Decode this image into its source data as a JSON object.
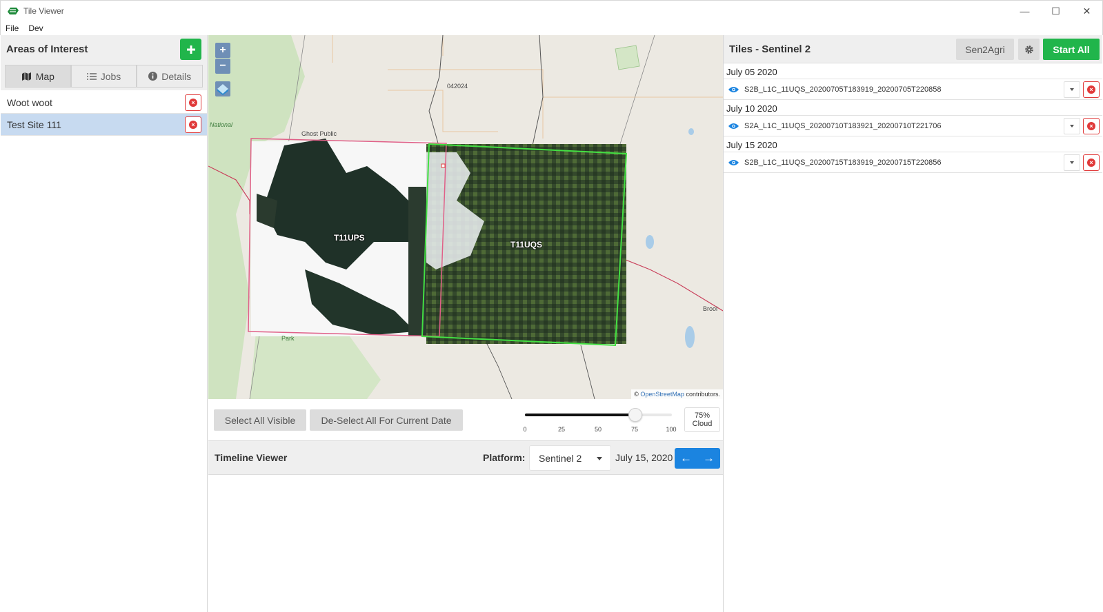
{
  "window": {
    "title": "Tile Viewer",
    "minimize_icon": "minimize-icon",
    "maximize_icon": "maximize-icon",
    "close_icon": "close-icon"
  },
  "menu": {
    "items": [
      "File",
      "Dev"
    ]
  },
  "aoi": {
    "title": "Areas of Interest",
    "add_icon": "plus-icon",
    "tabs": [
      {
        "label": "Map",
        "icon": "map-icon",
        "active": true
      },
      {
        "label": "Jobs",
        "icon": "list-icon",
        "active": false
      },
      {
        "label": "Details",
        "icon": "info-icon",
        "active": false
      }
    ],
    "items": [
      {
        "name": "Woot woot",
        "selected": false
      },
      {
        "name": "Test Site 111",
        "selected": true
      }
    ]
  },
  "map": {
    "tiles": [
      "T11UPS",
      "T11UQS"
    ],
    "labels": {
      "area_code": "042024",
      "ghost": "Ghost Public",
      "national": "National",
      "park": "Park",
      "brook": "Brool"
    },
    "attribution": {
      "prefix": "©",
      "link": "OpenStreetMap",
      "suffix": "contributors."
    }
  },
  "controls": {
    "select_all": "Select All Visible",
    "deselect_all": "De-Select All For Current Date",
    "slider": {
      "value": 75,
      "ticks": [
        "0",
        "25",
        "50",
        "75",
        "100"
      ]
    },
    "cloud_value": "75%",
    "cloud_label": "Cloud"
  },
  "timeline": {
    "title": "Timeline Viewer",
    "platform_label": "Platform:",
    "platform_value": "Sentinel 2",
    "date": "July 15, 2020",
    "prev_icon": "arrow-left-icon",
    "next_icon": "arrow-right-icon"
  },
  "tiles_panel": {
    "title": "Tiles - Sentinel 2",
    "sen2agri": "Sen2Agri",
    "start_all": "Start All",
    "groups": [
      {
        "date": "July 05 2020",
        "tile": "S2B_L1C_11UQS_20200705T183919_20200705T220858"
      },
      {
        "date": "July 10 2020",
        "tile": "S2A_L1C_11UQS_20200710T183921_20200710T221706"
      },
      {
        "date": "July 15 2020",
        "tile": "S2B_L1C_11UQS_20200715T183919_20200715T220856"
      }
    ]
  },
  "colors": {
    "accent_green": "#21b54b",
    "accent_blue": "#1b84e0",
    "danger": "#e03a3a",
    "selected_row": "#c7daf0"
  }
}
